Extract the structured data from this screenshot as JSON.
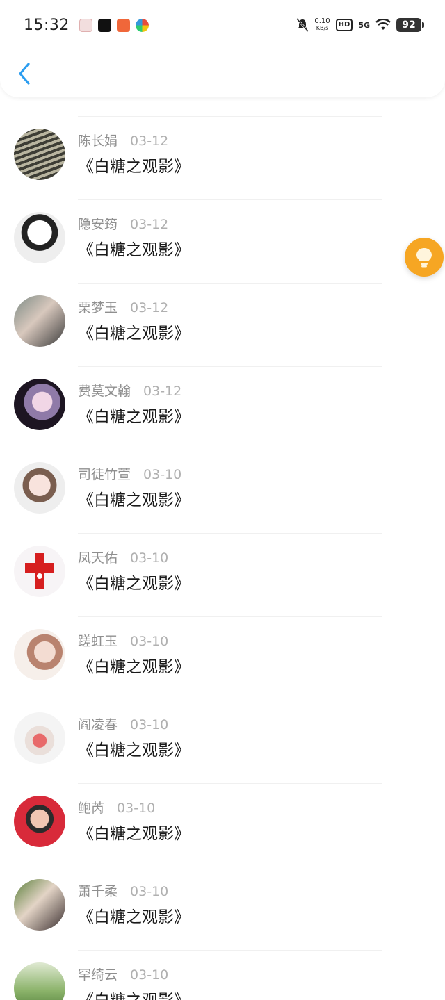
{
  "status_bar": {
    "time": "15:32",
    "net_speed_value": "0.10",
    "net_speed_unit": "KB/s",
    "hd_label": "HD",
    "network_label": "5G",
    "battery_level": "92"
  },
  "comments": [
    {
      "name": "陈长娟",
      "date": "03-12",
      "text": "《白糖之观影》"
    },
    {
      "name": "隐安筠",
      "date": "03-12",
      "text": "《白糖之观影》"
    },
    {
      "name": "栗梦玉",
      "date": "03-12",
      "text": "《白糖之观影》"
    },
    {
      "name": "费莫文翰",
      "date": "03-12",
      "text": "《白糖之观影》"
    },
    {
      "name": "司徒竹萱",
      "date": "03-10",
      "text": "《白糖之观影》"
    },
    {
      "name": "凤天佑",
      "date": "03-10",
      "text": "《白糖之观影》"
    },
    {
      "name": "蹉虹玉",
      "date": "03-10",
      "text": "《白糖之观影》"
    },
    {
      "name": "阎凌春",
      "date": "03-10",
      "text": "《白糖之观影》"
    },
    {
      "name": "鲍芮",
      "date": "03-10",
      "text": "《白糖之观影》"
    },
    {
      "name": "萧千柔",
      "date": "03-10",
      "text": "《白糖之观影》"
    },
    {
      "name": "罕绮云",
      "date": "03-10",
      "text": "《白糖之观影》"
    }
  ],
  "icons": {
    "back": "chevron-left-icon",
    "floating": "lightbulb-icon"
  },
  "colors": {
    "accent": "#2b9df0",
    "floating_button": "#f6a623",
    "name_text": "#8f8f8f",
    "date_text": "#b0b0b0"
  }
}
